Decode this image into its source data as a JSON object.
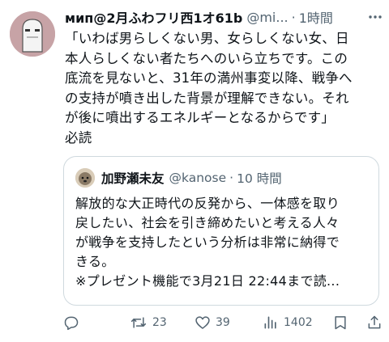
{
  "post": {
    "author_name": "мип@2月ふわフリ西1オ61b",
    "handle": "@mi...",
    "separator": "·",
    "time": "1時間",
    "body_lines": [
      "「いわば男らしくない男、女らしくない女、日",
      "本人らしくない者たちへのいら立ちです。この",
      "底流を見ないと、31年の満州事変以降、戦争へ",
      "の支持が噴き出した背景が理解できない。それ",
      "が後に噴出するエネルギーとなるからです」",
      "必読"
    ]
  },
  "quote": {
    "author_name": "加野瀬未友",
    "handle": "@kanose",
    "separator": "·",
    "time": "10 時間",
    "body_lines": [
      "解放的な大正時代の反発から、一体感を取り",
      "戻したい、社会を引き締めたいと考える人々",
      "が戦争を支持したという分析は非常に納得で",
      "きる。",
      "※プレゼント機能で3月21日 22:44まで読..."
    ]
  },
  "actions": {
    "reply_count": "",
    "retweet_count": "23",
    "like_count": "39",
    "view_count": "1402"
  },
  "icons": {
    "more": "more-icon",
    "reply": "reply-icon",
    "retweet": "retweet-icon",
    "like": "heart-icon",
    "views": "views-icon",
    "bookmark": "bookmark-icon",
    "share": "share-icon"
  },
  "colors": {
    "text": "#0f1419",
    "secondary": "#536471",
    "border": "#cfd9de"
  }
}
